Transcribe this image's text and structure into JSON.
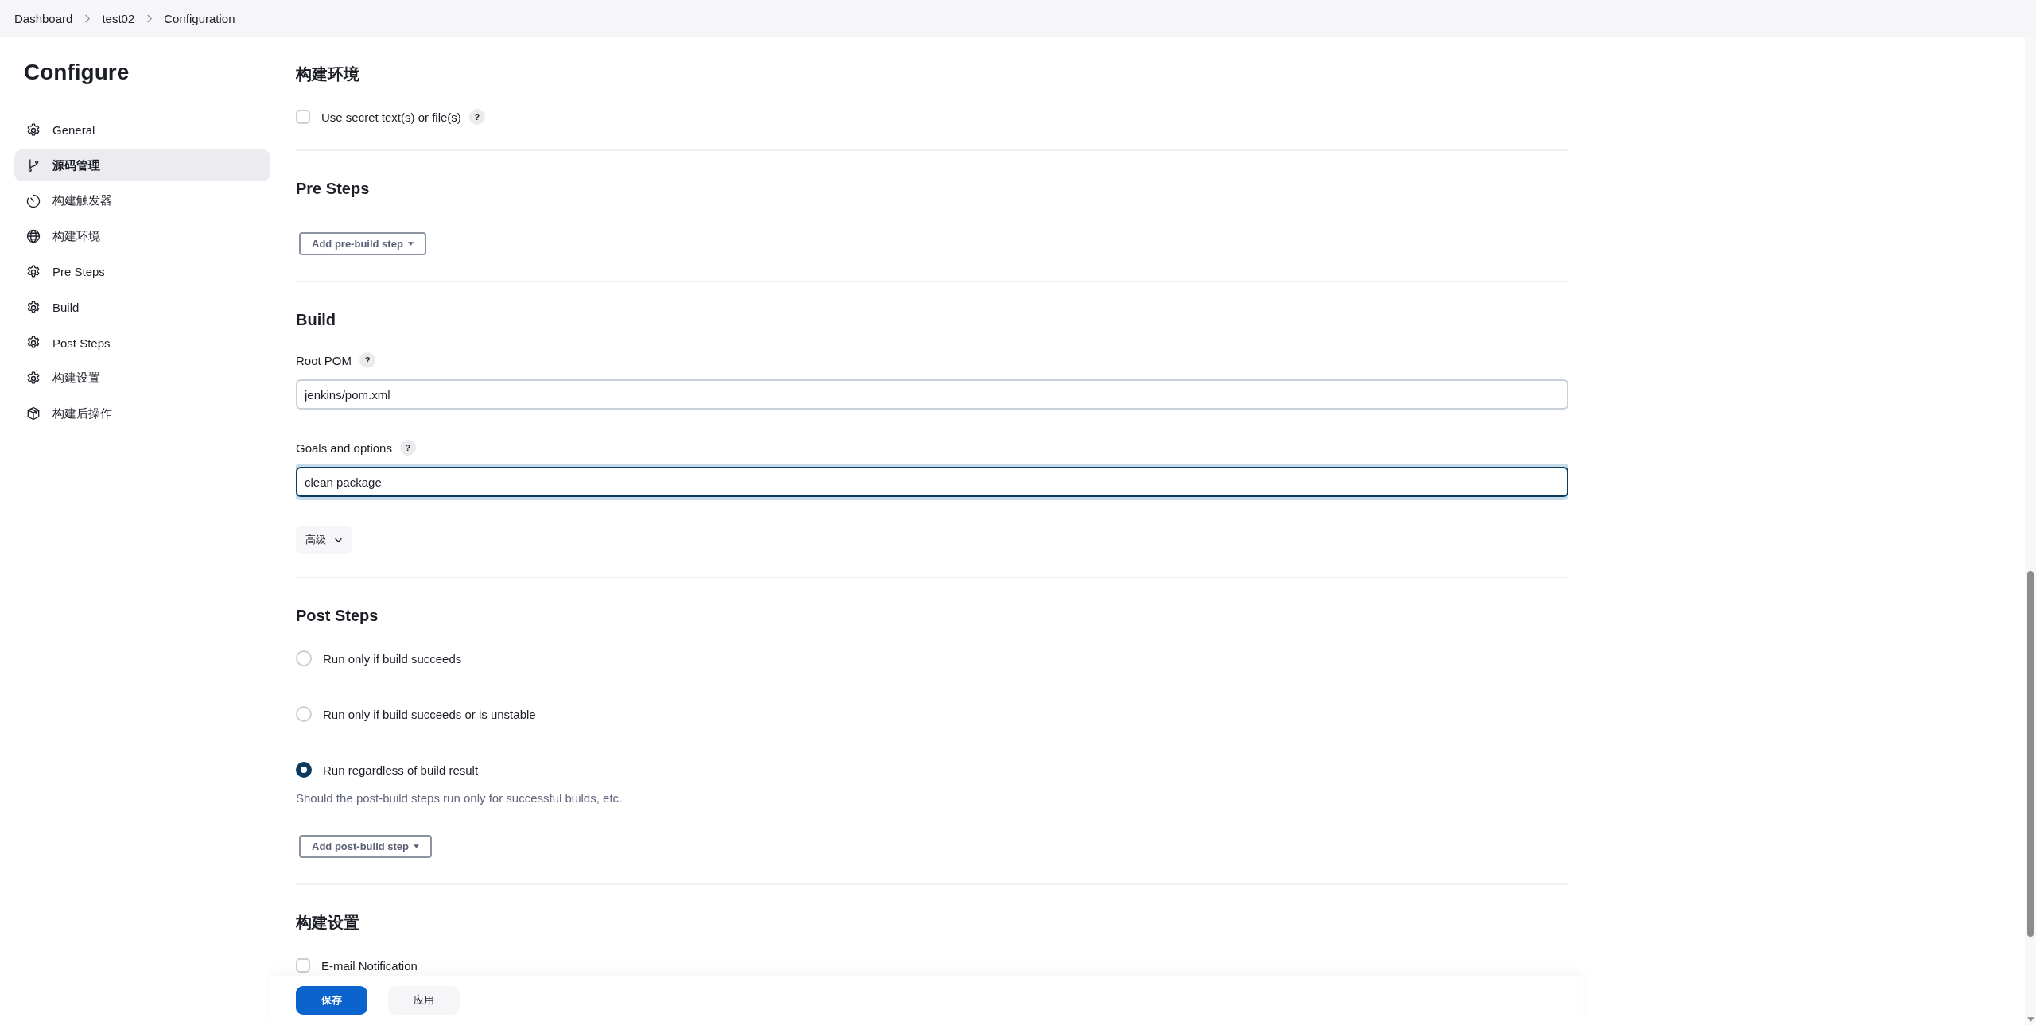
{
  "breadcrumb": [
    {
      "label": "Dashboard"
    },
    {
      "label": "test02"
    },
    {
      "label": "Configuration"
    }
  ],
  "sidebar": {
    "title": "Configure",
    "items": [
      {
        "label": "General",
        "kind": "gear",
        "selected": false
      },
      {
        "label": "源码管理",
        "kind": "branch",
        "selected": true
      },
      {
        "label": "构建触发器",
        "kind": "timer",
        "selected": false
      },
      {
        "label": "构建环境",
        "kind": "globe",
        "selected": false
      },
      {
        "label": "Pre Steps",
        "kind": "gear",
        "selected": false
      },
      {
        "label": "Build",
        "kind": "gear",
        "selected": false
      },
      {
        "label": "Post Steps",
        "kind": "gear",
        "selected": false
      },
      {
        "label": "构建设置",
        "kind": "gear",
        "selected": false
      },
      {
        "label": "构建后操作",
        "kind": "box",
        "selected": false
      }
    ]
  },
  "sections": [
    {
      "title": "构建环境",
      "items": [
        {
          "kind": "checkbox",
          "label": "Use secret text(s) or file(s)",
          "checked": false,
          "help": "?"
        }
      ]
    },
    {
      "title": "Pre Steps",
      "items": [
        {
          "kind": "dropdown_button",
          "label": "Add pre-build step"
        }
      ]
    },
    {
      "title": "Build",
      "items": [
        {
          "kind": "text_field",
          "label": "Root POM",
          "help": "?",
          "value": "jenkins/pom.xml",
          "focused": false
        },
        {
          "kind": "text_field",
          "label": "Goals and options",
          "help": "?",
          "value": "clean package",
          "focused": true
        },
        {
          "kind": "expander",
          "label": "高级"
        }
      ]
    },
    {
      "title": "Post Steps",
      "items": [
        {
          "kind": "radio",
          "label": "Run only if build succeeds",
          "selected": false
        },
        {
          "kind": "radio",
          "label": "Run only if build succeeds or is unstable",
          "selected": false
        },
        {
          "kind": "radio",
          "label": "Run regardless of build result",
          "selected": true
        },
        {
          "kind": "description",
          "text": "Should the post-build steps run only for successful builds, etc."
        },
        {
          "kind": "dropdown_button",
          "label": "Add post-build step"
        }
      ]
    },
    {
      "title": "构建设置",
      "items": [
        {
          "kind": "checkbox",
          "label": "E-mail Notification",
          "checked": false
        }
      ]
    }
  ],
  "footer": {
    "buttons": [
      {
        "label": "保存",
        "primary": true
      },
      {
        "label": "应用",
        "primary": false
      }
    ]
  }
}
